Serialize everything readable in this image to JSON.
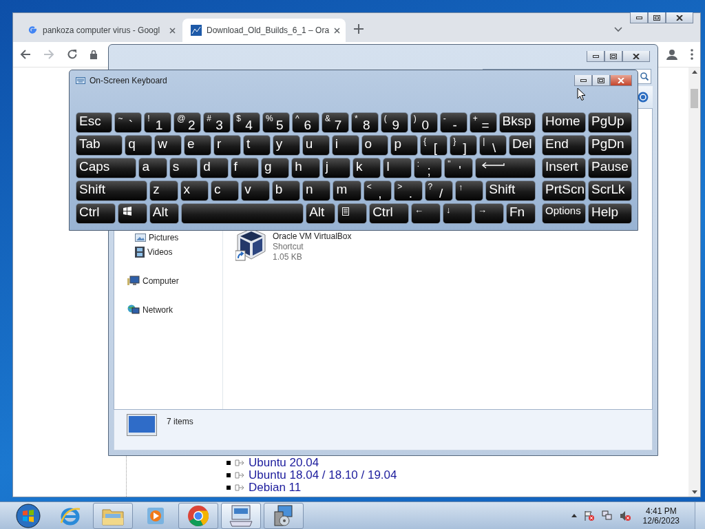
{
  "chrome": {
    "tabs": [
      {
        "title": "pankoza computer virus - Googl",
        "kind": "google",
        "selected": false
      },
      {
        "title": "Download_Old_Builds_6_1 – Ora",
        "kind": "page",
        "selected": true
      }
    ],
    "links": [
      "Ubuntu 20.04",
      "Ubuntu 18.04 / 18.10 / 19.04",
      "Debian 11"
    ]
  },
  "explorer": {
    "library_items": [
      {
        "label": "Pictures",
        "kind": "pictures"
      },
      {
        "label": "Videos",
        "kind": "videos"
      }
    ],
    "places": [
      {
        "label": "Computer",
        "kind": "computer"
      },
      {
        "label": "Network",
        "kind": "network"
      }
    ],
    "file": {
      "name": "Oracle VM VirtualBox",
      "type": "Shortcut",
      "size": "1.05 KB"
    },
    "status": "7 items"
  },
  "keyboard": {
    "title": "On-Screen Keyboard",
    "rows": [
      {
        "keys": [
          {
            "kind": "word",
            "label": "Esc"
          },
          {
            "kind": "pair",
            "shift": "~",
            "label": "`"
          },
          {
            "kind": "pair",
            "shift": "!",
            "label": "1"
          },
          {
            "kind": "pair",
            "shift": "@",
            "label": "2"
          },
          {
            "kind": "pair",
            "shift": "#",
            "label": "3"
          },
          {
            "kind": "pair",
            "shift": "$",
            "label": "4"
          },
          {
            "kind": "pair",
            "shift": "%",
            "label": "5"
          },
          {
            "kind": "pair",
            "shift": "^",
            "label": "6"
          },
          {
            "kind": "pair",
            "shift": "&",
            "label": "7"
          },
          {
            "kind": "pair",
            "shift": "*",
            "label": "8"
          },
          {
            "kind": "pair",
            "shift": "(",
            "label": "9"
          },
          {
            "kind": "pair",
            "shift": ")",
            "label": "0"
          },
          {
            "kind": "pair",
            "shift": "-",
            "label": "-"
          },
          {
            "kind": "pair",
            "shift": "+",
            "label": "="
          },
          {
            "kind": "word",
            "label": "Bksp"
          }
        ]
      },
      {
        "keys": [
          {
            "kind": "word",
            "label": "Tab"
          },
          {
            "kind": "word",
            "label": "q"
          },
          {
            "kind": "word",
            "label": "w"
          },
          {
            "kind": "word",
            "label": "e"
          },
          {
            "kind": "word",
            "label": "r"
          },
          {
            "kind": "word",
            "label": "t"
          },
          {
            "kind": "word",
            "label": "y"
          },
          {
            "kind": "word",
            "label": "u"
          },
          {
            "kind": "word",
            "label": "i"
          },
          {
            "kind": "word",
            "label": "o"
          },
          {
            "kind": "word",
            "label": "p"
          },
          {
            "kind": "pair",
            "shift": "{",
            "label": "["
          },
          {
            "kind": "pair",
            "shift": "}",
            "label": "]"
          },
          {
            "kind": "pair",
            "shift": "|",
            "label": "\\"
          },
          {
            "kind": "word",
            "label": "Del"
          }
        ]
      },
      {
        "keys": [
          {
            "kind": "word",
            "label": "Caps"
          },
          {
            "kind": "word",
            "label": "a"
          },
          {
            "kind": "word",
            "label": "s"
          },
          {
            "kind": "word",
            "label": "d"
          },
          {
            "kind": "word",
            "label": "f"
          },
          {
            "kind": "word",
            "label": "g"
          },
          {
            "kind": "word",
            "label": "h"
          },
          {
            "kind": "word",
            "label": "j"
          },
          {
            "kind": "word",
            "label": "k"
          },
          {
            "kind": "word",
            "label": "l"
          },
          {
            "kind": "pair",
            "shift": ":",
            "label": ";"
          },
          {
            "kind": "pair",
            "shift": "\"",
            "label": "'"
          },
          {
            "kind": "enter"
          }
        ]
      },
      {
        "keys": [
          {
            "kind": "word",
            "label": "Shift"
          },
          {
            "kind": "word",
            "label": "z"
          },
          {
            "kind": "word",
            "label": "x"
          },
          {
            "kind": "word",
            "label": "c"
          },
          {
            "kind": "word",
            "label": "v"
          },
          {
            "kind": "word",
            "label": "b"
          },
          {
            "kind": "word",
            "label": "n"
          },
          {
            "kind": "word",
            "label": "m"
          },
          {
            "kind": "pair",
            "shift": "<",
            "label": ","
          },
          {
            "kind": "pair",
            "shift": ">",
            "label": "."
          },
          {
            "kind": "pair",
            "shift": "?",
            "label": "/"
          },
          {
            "kind": "arrow",
            "label": "↑"
          },
          {
            "kind": "word",
            "label": "Shift"
          }
        ]
      },
      {
        "keys": [
          {
            "kind": "word",
            "label": "Ctrl"
          },
          {
            "kind": "win"
          },
          {
            "kind": "word",
            "label": "Alt"
          },
          {
            "kind": "space"
          },
          {
            "kind": "word",
            "label": "Alt"
          },
          {
            "kind": "menu"
          },
          {
            "kind": "word",
            "label": "Ctrl"
          },
          {
            "kind": "arrow",
            "label": "←"
          },
          {
            "kind": "arrow",
            "label": "↓"
          },
          {
            "kind": "arrow",
            "label": "→"
          },
          {
            "kind": "word",
            "label": "Fn"
          }
        ]
      }
    ],
    "nav_keys": [
      {
        "kind": "word",
        "label": "Home"
      },
      {
        "kind": "word",
        "label": "PgUp"
      },
      {
        "kind": "word",
        "label": "End"
      },
      {
        "kind": "word",
        "label": "PgDn"
      },
      {
        "kind": "word",
        "label": "Insert"
      },
      {
        "kind": "word",
        "label": "Pause"
      },
      {
        "kind": "word",
        "label": "PrtScn"
      },
      {
        "kind": "word",
        "label": "ScrLk"
      },
      {
        "kind": "small",
        "label": "Options"
      },
      {
        "kind": "word",
        "label": "Help"
      }
    ]
  },
  "taskbar": {
    "apps": [
      {
        "kind": "ie",
        "open": false,
        "selected": false
      },
      {
        "kind": "folder",
        "open": true,
        "selected": false
      },
      {
        "kind": "media",
        "open": false,
        "selected": false
      },
      {
        "kind": "chrome",
        "open": true,
        "selected": false
      },
      {
        "kind": "osk",
        "open": true,
        "selected": true
      },
      {
        "kind": "setup",
        "open": true,
        "selected": false
      }
    ],
    "time": "4:41 PM",
    "date": "12/6/2023"
  }
}
